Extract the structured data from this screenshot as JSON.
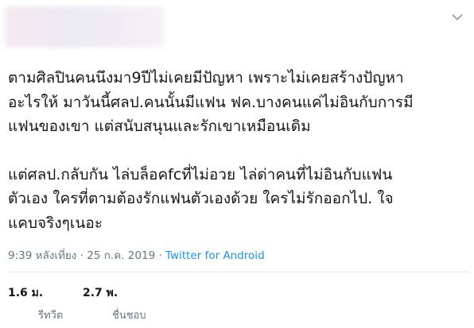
{
  "tweet": {
    "paragraphs": [
      "ตามศิลปินคนนึงมา9ปีไม่เคยมีปัญหา เพราะไม่เคยสร้างปัญหา\nอะไรให้ มาวันนี้ศลป.คนนั้นมีแฟน ฟค.บางคนแค่ไม่อินกับการมี\nแฟนของเขา แต่สนับสนุนและรักเขาเหมือนเดิม",
      "แต่ศลป.กลับกัน ไล่บล็อคfcที่ไม่อวย ไล่ด่าคนที่ไม่อินกับแฟน\nตัวเอง ใครที่ตามต้องรักแฟนตัวเองด้วย ใครไม่รักออกไป. ใจ\nแคบจริงๆเนอะ"
    ],
    "timestamp": "9:39 หลังเที่ยง · 25 ก.ค. 2019 · ",
    "source": "Twitter for Android"
  },
  "stats": {
    "retweets": {
      "count": "1.6 ม.",
      "label": "รีทวีต"
    },
    "likes": {
      "count": "2.7 พ.",
      "label": "ชื่นชอบ"
    }
  },
  "icons": {
    "menu": "chevron-down-icon"
  },
  "colors": {
    "text": "#14171a",
    "muted": "#657786",
    "link": "#1b95e0",
    "divider": "#e6ecf0"
  }
}
